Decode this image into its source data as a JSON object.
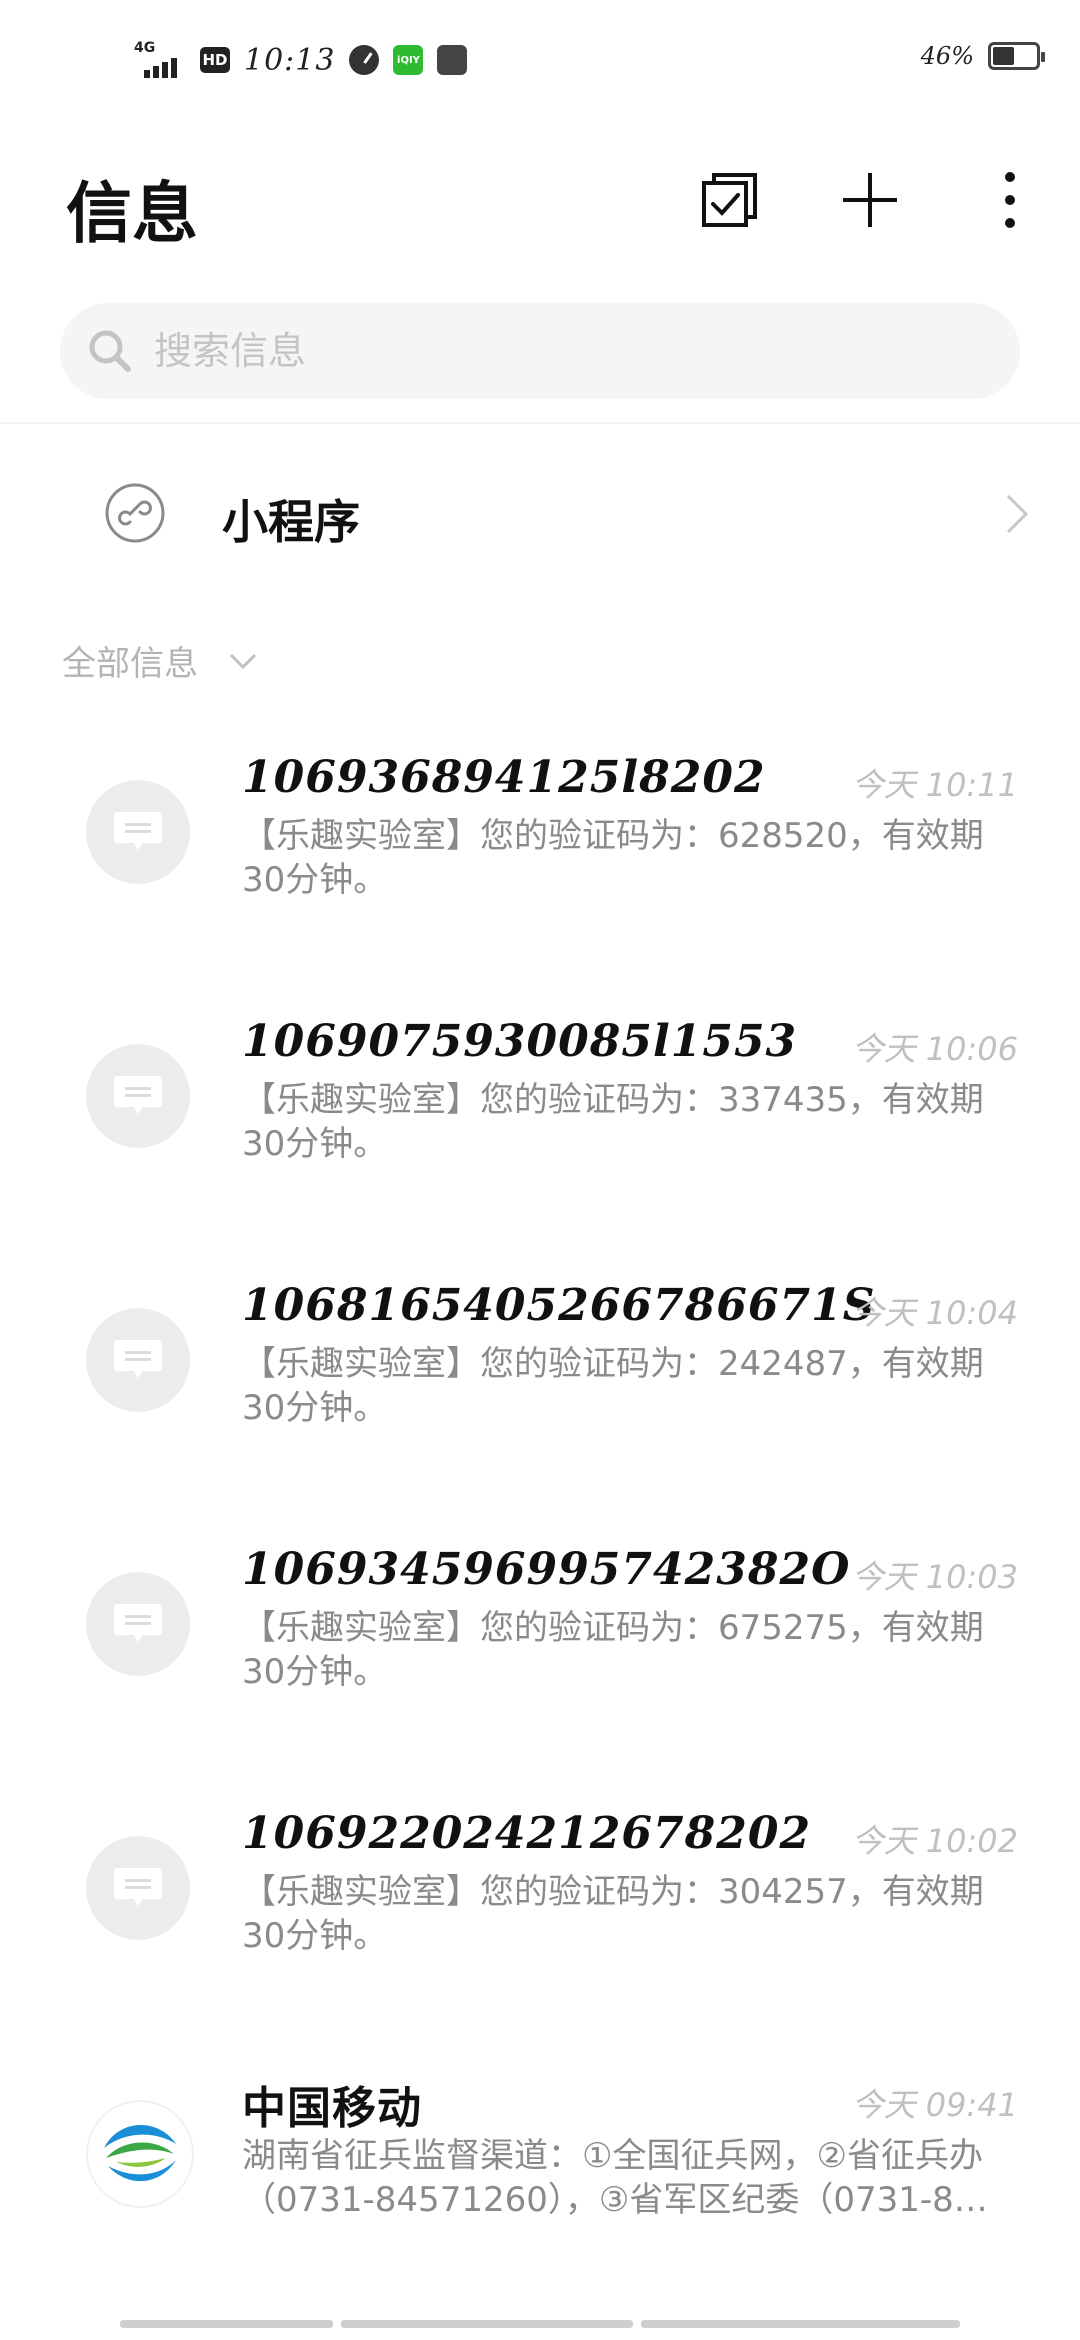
{
  "status_bar": {
    "network": "4G",
    "hd": "HD",
    "time": "10:13",
    "app_badge": "iQIY",
    "battery_percent": "46%",
    "battery_level": 0.46
  },
  "header": {
    "title": "信息",
    "icons": [
      "checkbox-select-icon",
      "plus-icon",
      "more-vertical-icon"
    ]
  },
  "search": {
    "placeholder": "搜索信息",
    "value": ""
  },
  "mini_program": {
    "label": "小程序"
  },
  "section": {
    "label": "全部信息"
  },
  "messages": [
    {
      "sender": "106936894125l8202",
      "time": "今天 10:11",
      "preview": "【乐趣实验室】您的验证码为：628520，有效期30分钟。"
    },
    {
      "sender": "1069075930085l1553",
      "time": "今天 10:06",
      "preview": "【乐趣实验室】您的验证码为：337435，有效期30分钟。"
    },
    {
      "sender": "1068165405266786671S",
      "time": "今天 10:04",
      "preview": "【乐趣实验室】您的验证码为：242487，有效期30分钟。"
    },
    {
      "sender": "106934596995742382O",
      "time": "今天 10:03",
      "preview": "【乐趣实验室】您的验证码为：675275，有效期30分钟。"
    },
    {
      "sender": "106922024212678202",
      "time": "今天 10:02",
      "preview": "【乐趣实验室】您的验证码为：304257，有效期30分钟。"
    },
    {
      "sender": "中国移动",
      "time": "今天 09:41",
      "preview": "湖南省征兵监督渠道：①全国征兵网，②省征兵办（0731-84571260），③省军区纪委（0731-8…"
    }
  ],
  "colors": {
    "avatar_bg": "#ececec",
    "muted_text": "#8a8a8a",
    "time_text": "#c0c0c0",
    "search_bg": "#f5f5f5"
  }
}
